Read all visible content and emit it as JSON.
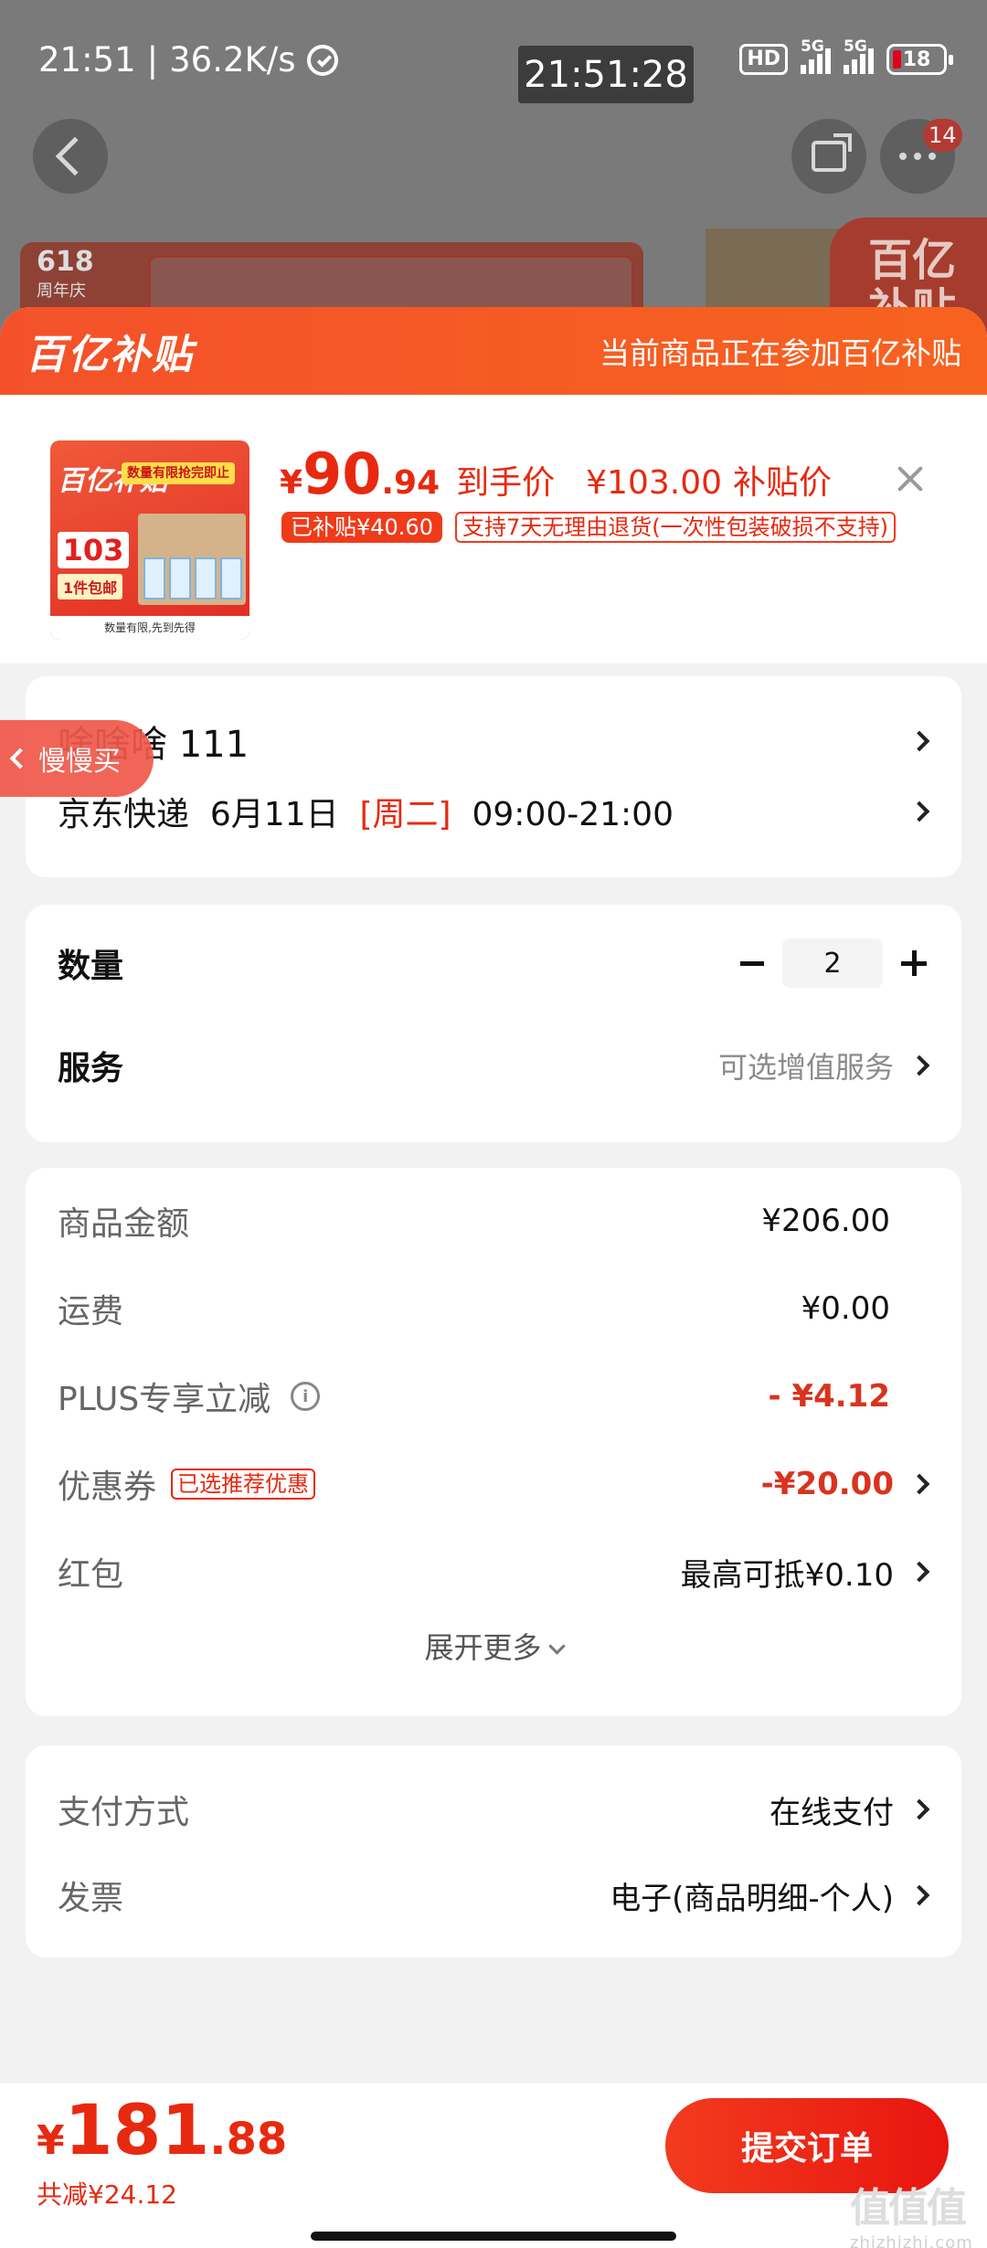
{
  "status_bar": {
    "time": "21:51",
    "speed": "36.2K/s",
    "center_clock": "21:51:28",
    "hd_label": "HD",
    "net1": "5G",
    "net2": "5G",
    "battery": "18"
  },
  "nav": {
    "notif_count": "14"
  },
  "background": {
    "banner_618": "618",
    "banner_618_sub": "周年庆",
    "right_tag": "百亿补贴"
  },
  "sheet": {
    "logo": "百亿补贴",
    "notice": "当前商品正在参加百亿补贴"
  },
  "product": {
    "thumb": {
      "title": "百亿补贴",
      "tag": "数量有限抢完即止",
      "price": "103",
      "ship": "1件包邮",
      "foot": "数量有限,先到先得"
    },
    "yen": "¥",
    "price_int": "90",
    "price_dec": ".94",
    "price_label": "到手价",
    "subsidy_price": "¥103.00",
    "subsidy_label": "补贴价",
    "subsidized_tag": "已补贴¥40.60",
    "return_tag": "支持7天无理由退货(一次性包装破损不支持)"
  },
  "address": {
    "name": "啥啥啥 111",
    "carrier": "京东快递",
    "date": "6月11日",
    "weekday": "[周二]",
    "window": "09:00-21:00"
  },
  "quantity": {
    "label": "数量",
    "value": "2",
    "service_label": "服务",
    "service_value": "可选增值服务"
  },
  "price_detail": {
    "goods_label": "商品金额",
    "goods_value": "¥206.00",
    "freight_label": "运费",
    "freight_value": "¥0.00",
    "plus_label": "PLUS专享立减",
    "plus_value": "- ¥4.12",
    "coupon_label": "优惠券",
    "coupon_tag": "已选推荐优惠",
    "coupon_value": "-¥20.00",
    "redpack_label": "红包",
    "redpack_value": "最高可抵¥0.10",
    "expand": "展开更多"
  },
  "payment": {
    "method_label": "支付方式",
    "method_value": "在线支付",
    "invoice_label": "发票",
    "invoice_value": "电子(商品明细-个人)"
  },
  "floating": {
    "slow_buy": "慢慢买"
  },
  "bottom": {
    "yen": "¥",
    "total_int": "181",
    "total_dec": ".88",
    "saved": "共减¥24.12",
    "submit": "提交订单"
  },
  "watermark": {
    "main": "值值值",
    "sub": "zhizhizhi.com"
  },
  "colors": {
    "accent": "#e7290f",
    "header_orange": "#f4512a"
  }
}
